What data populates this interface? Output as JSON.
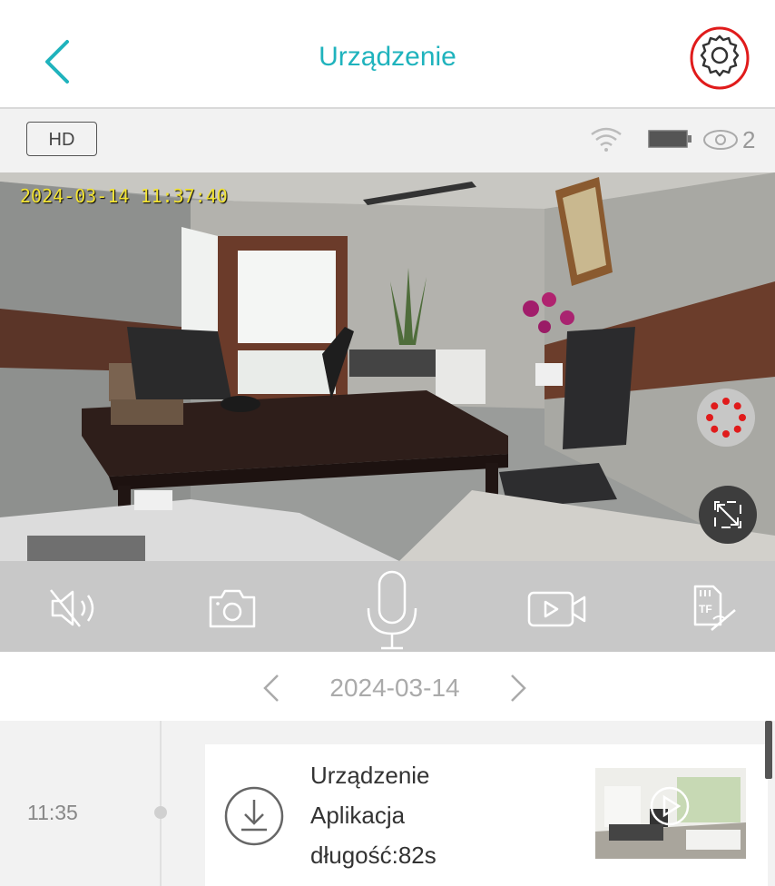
{
  "header": {
    "title": "Urządzenie",
    "back_icon": "chevron-left-icon",
    "settings_icon": "gear-icon",
    "accent_color": "#1fb3bd",
    "highlight_color": "#e01b1b"
  },
  "status_bar": {
    "quality_label": "HD",
    "viewer_count": "2",
    "icons": [
      "wifi-icon",
      "battery-icon",
      "eye-icon"
    ]
  },
  "video": {
    "timestamp": "2024-03-14 11:37:40",
    "timestamp_color": "#f1e233",
    "record_indicator_icon": "recording-spinner-icon",
    "fullscreen_icon": "fullscreen-icon"
  },
  "toolbar": {
    "buttons": [
      {
        "name": "mute",
        "icon": "speaker-muted-icon"
      },
      {
        "name": "snapshot",
        "icon": "camera-icon"
      },
      {
        "name": "talk",
        "icon": "microphone-icon"
      },
      {
        "name": "record",
        "icon": "video-record-icon"
      },
      {
        "name": "tf-card",
        "icon": "tf-card-icon"
      }
    ]
  },
  "date_nav": {
    "date": "2024-03-14",
    "prev_icon": "chevron-left-icon",
    "next_icon": "chevron-right-icon"
  },
  "timeline": {
    "entries": [
      {
        "time": "11:35",
        "line1": "Urządzenie",
        "line2": "Aplikacja",
        "line3": "długość:82s",
        "icon": "download-icon",
        "thumbnail_icon": "play-icon"
      }
    ]
  }
}
